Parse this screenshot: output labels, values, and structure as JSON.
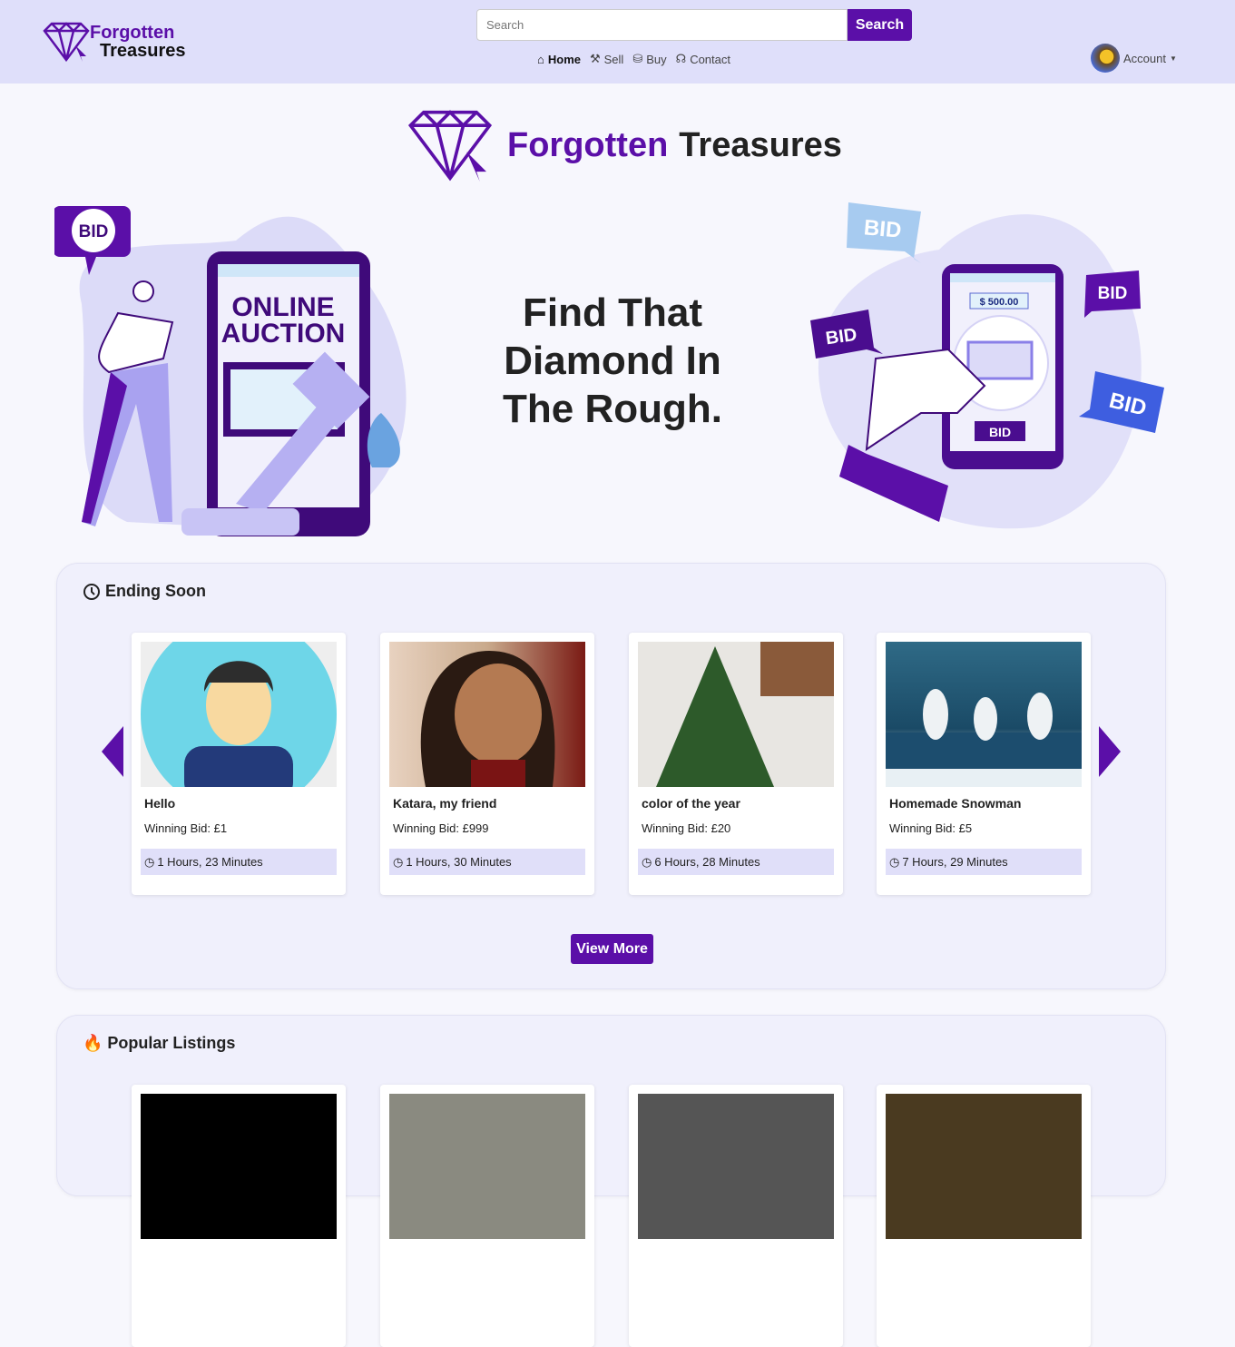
{
  "header": {
    "logo_line1": "Forgotten",
    "logo_line2": "Treasures",
    "search_placeholder": "Search",
    "search_button": "Search",
    "nav": [
      {
        "label": "Home",
        "icon": "home-icon"
      },
      {
        "label": "Sell",
        "icon": "gavel-icon"
      },
      {
        "label": "Buy",
        "icon": "hand-money-icon"
      },
      {
        "label": "Contact",
        "icon": "headphones-icon"
      }
    ],
    "account_label": "Account"
  },
  "brand": {
    "word1": "Forgotten",
    "word2": "Treasures"
  },
  "hero": {
    "tagline": "Find That Diamond In The Rough.",
    "left_illustration": {
      "bubble": "BID",
      "screen_line1": "ONLINE",
      "screen_line2": "AUCTION"
    },
    "right_illustration": {
      "price": "$ 500.00",
      "bid_button": "BID",
      "bubbles": [
        "BID",
        "BID",
        "BID",
        "BID"
      ]
    }
  },
  "ending_soon": {
    "title": "Ending Soon",
    "view_more": "View More",
    "items": [
      {
        "name": "Hello",
        "bid": "Winning Bid: £1",
        "time": "1 Hours, 23 Minutes"
      },
      {
        "name": "Katara, my friend",
        "bid": "Winning Bid: £999",
        "time": "1 Hours, 30 Minutes"
      },
      {
        "name": "color of the year",
        "bid": "Winning Bid: £20",
        "time": "6 Hours, 28 Minutes"
      },
      {
        "name": "Homemade Snowman",
        "bid": "Winning Bid: £5",
        "time": "7 Hours, 29 Minutes"
      }
    ]
  },
  "popular": {
    "title": "Popular Listings"
  },
  "colors": {
    "brand": "#5b0fa8",
    "header_bg": "#dfdffa",
    "time_bg": "#e0dff9"
  }
}
